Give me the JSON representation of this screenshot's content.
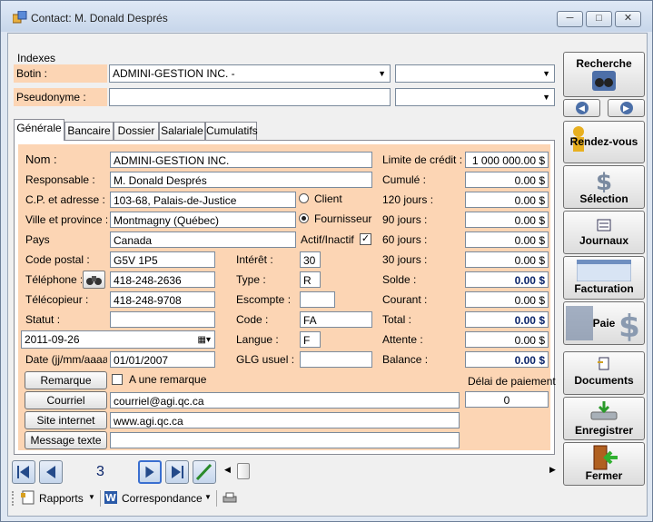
{
  "window": {
    "title": "Contact: M. Donald Després",
    "min": "▭",
    "max": "▢",
    "close": "✕"
  },
  "indexes": {
    "legend": "Indexes",
    "botin_label": "Botin :",
    "botin_value": "ADMINI-GESTION INC.  -",
    "botin_value2": "",
    "pseudonyme_label": "Pseudonyme :",
    "pseudonyme_value": "",
    "pseudonyme_value2": ""
  },
  "tabs": [
    "Générale",
    "Bancaire",
    "Dossier",
    "Salariale",
    "Cumulatifs"
  ],
  "general": {
    "nom_label": "Nom :",
    "nom": "ADMINI-GESTION INC.",
    "responsable_label": "Responsable :",
    "responsable": "M. Donald Després",
    "cp_label": "C.P. et adresse :",
    "cp": "103-68, Palais-de-Justice",
    "ville_label": "Ville et province :",
    "ville": "Montmagny (Québec)",
    "pays_label": "Pays",
    "pays": "Canada",
    "code_postal_label": "Code postal :",
    "code_postal": "G5V 1P5",
    "telephone_label": "Téléphone :",
    "telephone": "418-248-2636",
    "telecopieur_label": "Télécopieur :",
    "telecopieur": "418-248-9708",
    "statut_label": "Statut :",
    "statut": "",
    "date_picker": "2011-09-26",
    "date_label": "Date (jj/mm/aaaa):",
    "date": "01/01/2007",
    "client_label": "Client",
    "fournisseur_label": "Fournisseur",
    "actif_label": "Actif/Inactif",
    "interet_label": "Intérêt :",
    "interet": "30",
    "type_label": "Type :",
    "type": "R",
    "escompte_label": "Escompte :",
    "escompte": "",
    "code_label": "Code :",
    "code": "FA",
    "langue_label": "Langue :",
    "langue": "F",
    "glg_label": "GLG usuel :",
    "glg": "",
    "remarque_btn": "Remarque",
    "une_remarque_label": "A une remarque",
    "courriel_btn": "Courriel",
    "courriel": "courriel@agi.qc.ca",
    "site_btn": "Site internet",
    "site": "www.agi.qc.ca",
    "message_btn": "Message texte",
    "message": ""
  },
  "finance": {
    "limite_label": "Limite de crédit :",
    "limite": "1 000 000.00 $",
    "cumule_label": "Cumulé :",
    "cumule": "0.00 $",
    "j120_label": "120 jours :",
    "j120": "0.00 $",
    "j90_label": "90 jours :",
    "j90": "0.00 $",
    "j60_label": "60 jours :",
    "j60": "0.00 $",
    "j30_label": "30 jours :",
    "j30": "0.00 $",
    "solde_label": "Solde :",
    "solde": "0.00 $",
    "courant_label": "Courant :",
    "courant": "0.00 $",
    "total_label": "Total :",
    "total": "0.00 $",
    "attente_label": "Attente :",
    "attente": "0.00 $",
    "balance_label": "Balance :",
    "balance": "0.00 $",
    "delai_label": "Délai de paiement",
    "delai": "0"
  },
  "sidebar": {
    "recherche": "Recherche",
    "rendez_vous": "Rendez-vous",
    "selection": "Sélection",
    "journaux": "Journaux",
    "facturation": "Facturation",
    "paie": "Paie",
    "documents": "Documents",
    "enregistrer": "Enregistrer",
    "fermer": "Fermer"
  },
  "nav": {
    "record_number": "3"
  },
  "toolbar": {
    "rapports": "Rapports",
    "correspondance": "Correspondance"
  },
  "colors": {
    "peach": "#fcd5b4",
    "accent": "#0a246a"
  }
}
